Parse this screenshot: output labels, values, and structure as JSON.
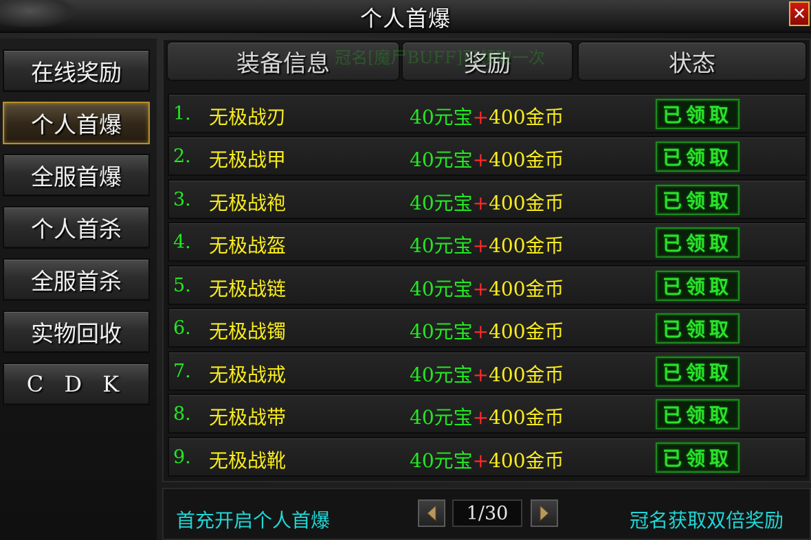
{
  "window": {
    "title": "个人首爆",
    "close_label": "✕"
  },
  "sidebar": {
    "items": [
      {
        "label": "在线奖励"
      },
      {
        "label": "个人首爆"
      },
      {
        "label": "全服首爆"
      },
      {
        "label": "个人首杀"
      },
      {
        "label": "全服首杀"
      },
      {
        "label": "实物回收"
      },
      {
        "label": "C D K"
      }
    ],
    "active_index": 1
  },
  "table": {
    "headers": [
      "装备信息",
      "奖励",
      "状态"
    ],
    "ghost_text": "冠名[魔尸BUFF]可领取一次",
    "rows": [
      {
        "num": "1.",
        "item": "无极战刃",
        "ingot": "40元宝",
        "plus": "+",
        "gold": "400金币",
        "status": "已领取"
      },
      {
        "num": "2.",
        "item": "无极战甲",
        "ingot": "40元宝",
        "plus": "+",
        "gold": "400金币",
        "status": "已领取"
      },
      {
        "num": "3.",
        "item": "无极战袍",
        "ingot": "40元宝",
        "plus": "+",
        "gold": "400金币",
        "status": "已领取"
      },
      {
        "num": "4.",
        "item": "无极战盔",
        "ingot": "40元宝",
        "plus": "+",
        "gold": "400金币",
        "status": "已领取"
      },
      {
        "num": "5.",
        "item": "无极战链",
        "ingot": "40元宝",
        "plus": "+",
        "gold": "400金币",
        "status": "已领取"
      },
      {
        "num": "6.",
        "item": "无极战镯",
        "ingot": "40元宝",
        "plus": "+",
        "gold": "400金币",
        "status": "已领取"
      },
      {
        "num": "7.",
        "item": "无极战戒",
        "ingot": "40元宝",
        "plus": "+",
        "gold": "400金币",
        "status": "已领取"
      },
      {
        "num": "8.",
        "item": "无极战带",
        "ingot": "40元宝",
        "plus": "+",
        "gold": "400金币",
        "status": "已领取"
      },
      {
        "num": "9.",
        "item": "无极战靴",
        "ingot": "40元宝",
        "plus": "+",
        "gold": "400金币",
        "status": "已领取"
      }
    ]
  },
  "footer": {
    "left_text": "首充开启个人首爆",
    "page": "1/30",
    "right_text": "冠名获取双倍奖励"
  },
  "colors": {
    "green": "#22e822",
    "yellow": "#f8ec1c",
    "red": "#ff2a2a",
    "cyan": "#1fd6d6",
    "active_border": "#b8902a"
  },
  "icons": {
    "prev": "left-arrow-icon",
    "next": "right-arrow-icon",
    "close": "close-icon"
  }
}
